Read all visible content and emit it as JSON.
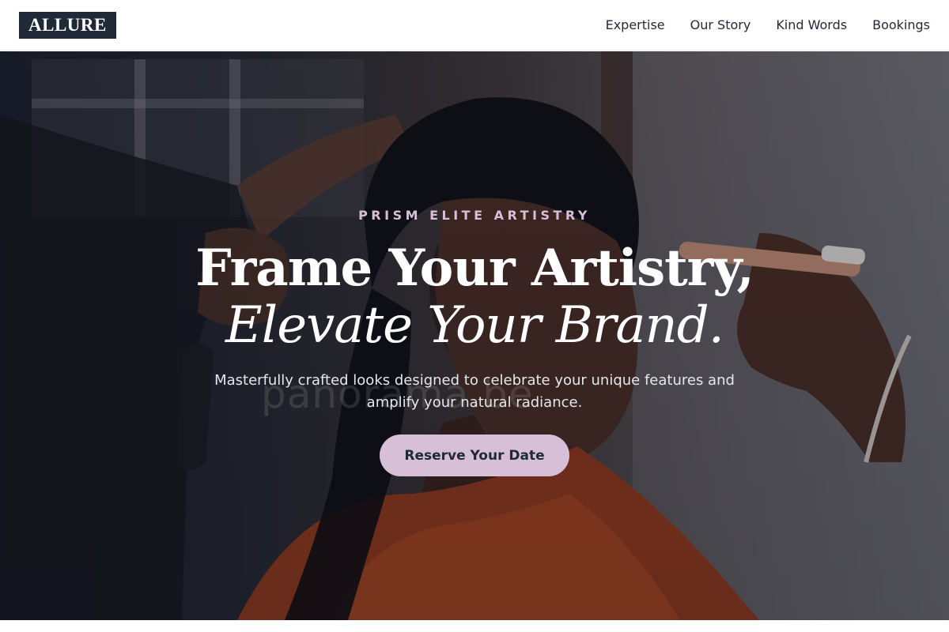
{
  "header": {
    "logo_text": "ALLURE",
    "nav": [
      {
        "label": "Expertise"
      },
      {
        "label": "Our Story"
      },
      {
        "label": "Kind Words"
      },
      {
        "label": "Bookings"
      }
    ]
  },
  "hero": {
    "eyebrow": "PRISM ELITE ARTISTRY",
    "headline_line1": "Frame Your Artistry,",
    "headline_line2": "Elevate Your Brand.",
    "subtitle": "Masterfully crafted looks designed to celebrate your unique features and amplify your natural radiance.",
    "cta_label": "Reserve Your Date",
    "watermark_text": "panorama.be",
    "background_description_icon": "makeup-artist-photo"
  },
  "colors": {
    "logo_bg": "#1f2937",
    "accent": "#d8bfd8",
    "text_dark": "#1f2937",
    "text_light": "#ffffff"
  }
}
